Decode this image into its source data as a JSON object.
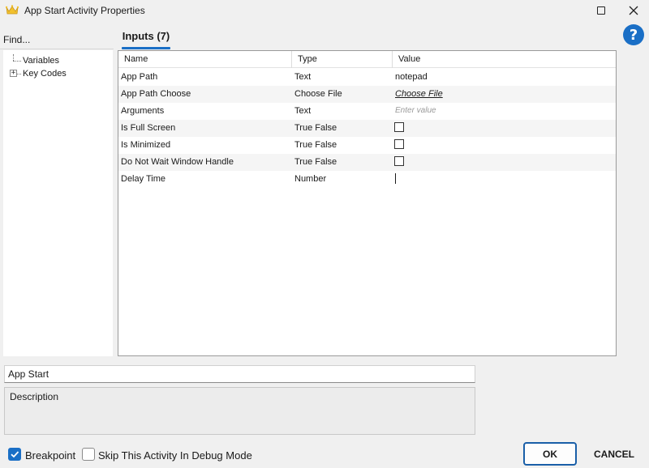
{
  "window": {
    "title": "App Start Activity Properties"
  },
  "help": {
    "glyph": "?"
  },
  "find": {
    "label": "Find..."
  },
  "tree": {
    "items": [
      {
        "label": "Variables",
        "expandable": false
      },
      {
        "label": "Key Codes",
        "expandable": true
      }
    ],
    "expander_glyph": "+"
  },
  "tab": {
    "label": "Inputs (7)"
  },
  "grid": {
    "columns": [
      "Name",
      "Type",
      "Value"
    ],
    "rows": [
      {
        "name": "App Path",
        "type": "Text",
        "value": "notepad"
      },
      {
        "name": "App Path Choose",
        "type": "Choose File",
        "value": "Choose File"
      },
      {
        "name": "Arguments",
        "type": "Text",
        "placeholder": "Enter value"
      },
      {
        "name": "Is Full Screen",
        "type": "True False",
        "checked": false
      },
      {
        "name": "Is Minimized",
        "type": "True False",
        "checked": false
      },
      {
        "name": "Do Not Wait Window Handle",
        "type": "True False",
        "checked": false
      },
      {
        "name": "Delay Time",
        "type": "Number",
        "value": ""
      }
    ]
  },
  "activity": {
    "name": "App Start",
    "description": "Description"
  },
  "footer": {
    "breakpoint_label": "Breakpoint",
    "breakpoint_checked": true,
    "skip_label": "Skip This Activity In Debug Mode",
    "skip_checked": false,
    "ok_label": "OK",
    "cancel_label": "CANCEL"
  },
  "colors": {
    "accent": "#1a6fc6",
    "background": "#f0f0f0"
  }
}
